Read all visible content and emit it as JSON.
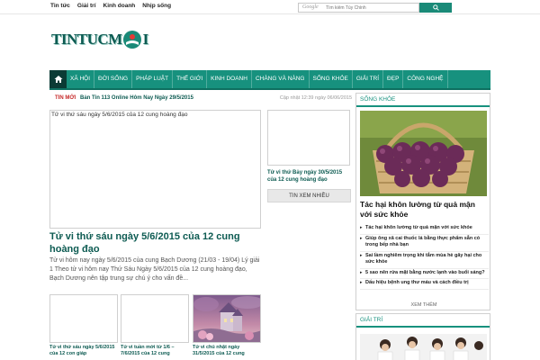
{
  "top_links": [
    "Tin tức",
    "Giải trí",
    "Kinh doanh",
    "Nhịp sống"
  ],
  "search": {
    "brand": "Google",
    "placeholder": "Tìm kiếm Tùy Chỉnh"
  },
  "logo": {
    "part1": "TINTUCM",
    "part2": "I"
  },
  "nav": {
    "items": [
      "XÃ HỘI",
      "ĐỜI SỐNG",
      "PHÁP LUẬT",
      "THẾ GIỚI",
      "KINH DOANH",
      "CHÀNG VÀ NÀNG",
      "SỐNG KHỎE",
      "GIẢI TRÍ",
      "ĐẸP",
      "CÔNG NGHỆ"
    ]
  },
  "ticker": {
    "label": "TIN MỚI",
    "headline": "Bản Tin 113 Online Hôm Nay Ngày 29/5/2015",
    "updated": "Cập nhật 12:39 ngày 06/06/2015"
  },
  "featured": {
    "img_alt": "Tử vi thứ sáu ngày 5/6/2015 của 12 cung hoàng đạo",
    "title": "Tử vi thứ sáu ngày 5/6/2015 của 12 cung hoàng đạo",
    "desc": "Tử vi hôm nay ngày 5/6/2015 của cung Bạch Dương (21/03 - 19/04) Lý giải 1 Theo tử vi hôm nay Thứ Sáu Ngày 5/6/2015 của 12 cung hoàng đạo, Bạch Dương nên tập trung sự chú ý cho vấn đề..."
  },
  "thumbs": [
    {
      "caption": "Tử vi thứ sáu ngày 5/6/2015 của 12 con giáp"
    },
    {
      "caption": "Tử vi tuần mới từ 1/6 – 7/6/2015 của 12 cung"
    },
    {
      "caption": "Tử vi chủ nhật ngày 31/5/2015 của 12 cung"
    }
  ],
  "middle": {
    "caption": "Tử vi thứ Bảy ngày 30/5/2015 của 12 cung hoàng đạo",
    "button": "TIN XEM NHIỀU"
  },
  "right": {
    "head": "SỐNG KHỎE",
    "title": "Tác hại khôn lường từ quả mận với sức khỏe",
    "items": [
      "Tác hại khôn lường từ quả mận với sức khỏe",
      "Giúp ông xã cai thuốc lá bằng thực phẩm sẵn có trong bếp nhà bạn",
      "Sai lầm nghiêm trọng khi tắm mùa hè gây hại cho sức khỏe",
      "5 sao nên rửa mặt bằng nước lạnh vào buổi sáng?",
      "Dấu hiệu bệnh ung thư máu và cách điều trị"
    ],
    "more": "XEM THÊM",
    "head2": "GIẢI TRÍ"
  }
}
